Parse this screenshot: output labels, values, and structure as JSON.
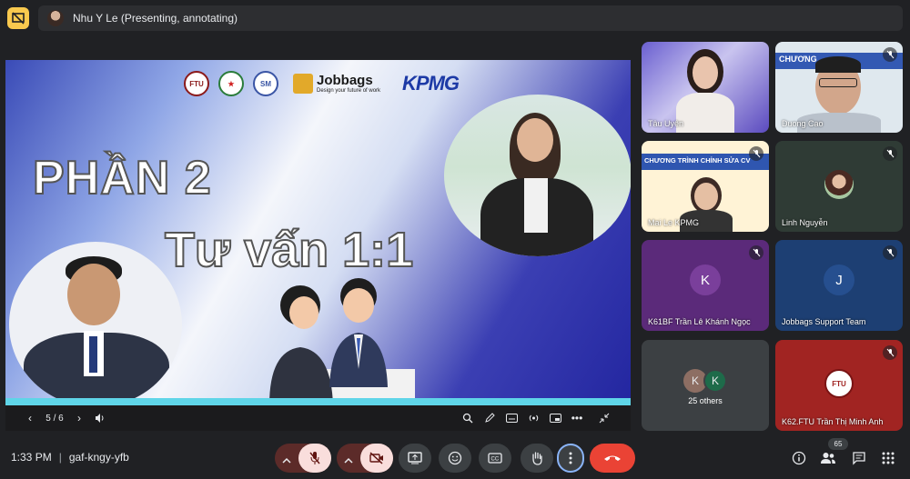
{
  "header": {
    "presenter_text": "Nhu Y Le (Presenting, annotating)"
  },
  "slide": {
    "logo_jobbags_name": "Jobbags",
    "logo_jobbags_tagline": "Design your future of work",
    "logo_kpmg": "KPMG",
    "title_line1": "PHẦN 2",
    "title_line2": "Tư vấn 1:1",
    "page_indicator": "5 / 6"
  },
  "participants": [
    {
      "name": "Tâu Uyên",
      "muted": false
    },
    {
      "name": "Duong Cao",
      "muted": true
    },
    {
      "name": "Mai Le KPMG",
      "muted": true
    },
    {
      "name": "Linh Nguyễn",
      "muted": true
    },
    {
      "name": "K61BF Trần Lê Khánh Ngọc",
      "muted": true,
      "initial": "K"
    },
    {
      "name": "Jobbags Support Team",
      "muted": true,
      "initial": "J"
    },
    {
      "name": "25 others",
      "initials": [
        "K",
        "K"
      ]
    },
    {
      "name": "K62.FTU Trần Thị Minh Anh",
      "muted": true
    }
  ],
  "tile_text": {
    "duong_banner": "CHƯƠNG",
    "mai_banner": "CHƯƠNG TRÌNH CHỈNH SỬA CV"
  },
  "footer": {
    "time": "1:33 PM",
    "separator": "|",
    "meeting_code": "gaf-kngy-yfb",
    "participant_count": "65"
  },
  "colors": {
    "background": "#202124",
    "end_call": "#ea4335",
    "muted_pink": "#f9dedc",
    "avatar_purple": "#5b2a7a",
    "avatar_blue": "#1d3f73",
    "avatar_red": "#a12422"
  }
}
